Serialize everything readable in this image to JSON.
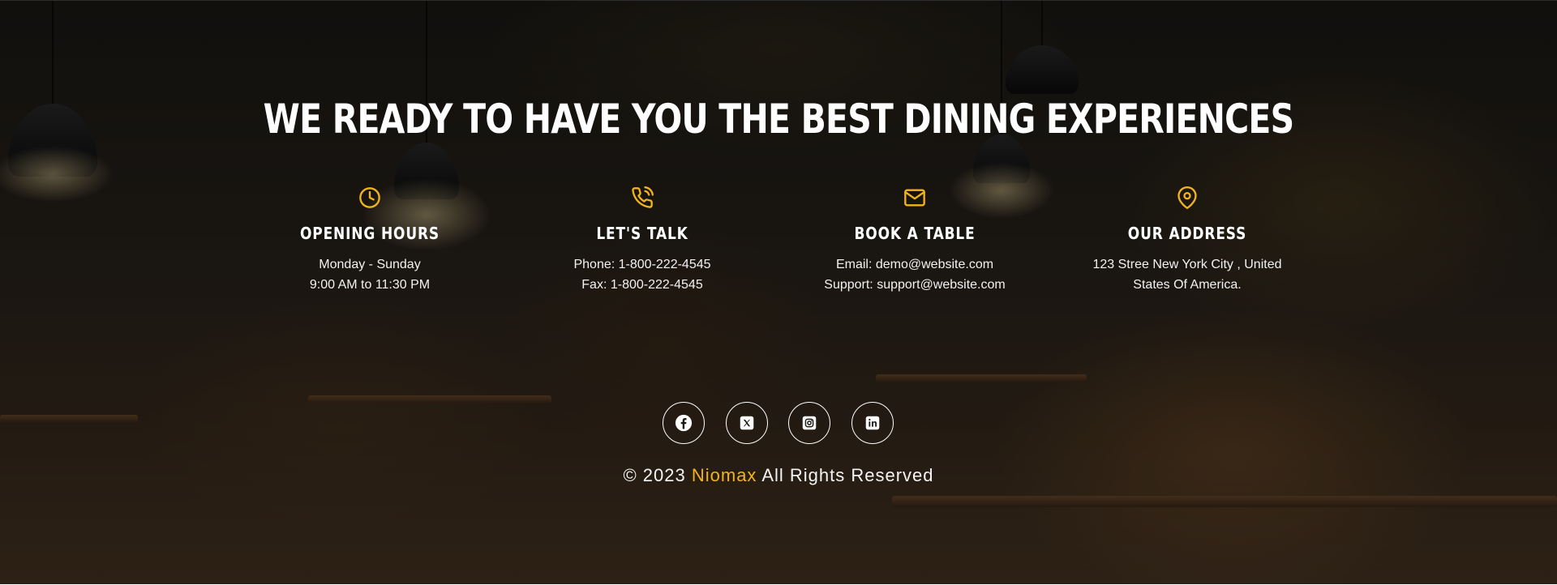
{
  "colors": {
    "accent": "#f2b31c",
    "text": "#ffffff",
    "overlay": "#000000"
  },
  "heading": "WE READY TO HAVE YOU THE BEST DINING EXPERIENCES",
  "info_columns": [
    {
      "icon": "clock-icon",
      "title": "OPENING HOURS",
      "lines": [
        "Monday - Sunday",
        "9:00 AM to 11:30 PM"
      ]
    },
    {
      "icon": "phone-icon",
      "title": "LET'S TALK",
      "lines": [
        "Phone: 1-800-222-4545",
        "Fax: 1-800-222-4545"
      ]
    },
    {
      "icon": "mail-icon",
      "title": "BOOK A TABLE",
      "lines": [
        "Email: demo@website.com",
        "Support: support@website.com"
      ]
    },
    {
      "icon": "map-pin-icon",
      "title": "OUR ADDRESS",
      "lines": [
        "123 Stree New York City , United",
        "States Of America."
      ]
    }
  ],
  "socials": [
    {
      "icon": "facebook-icon"
    },
    {
      "icon": "x-twitter-icon"
    },
    {
      "icon": "instagram-icon"
    },
    {
      "icon": "linkedin-icon"
    }
  ],
  "copyright": {
    "prefix": "© 2023",
    "brand": "Niomax",
    "suffix": "All Rights Reserved"
  }
}
